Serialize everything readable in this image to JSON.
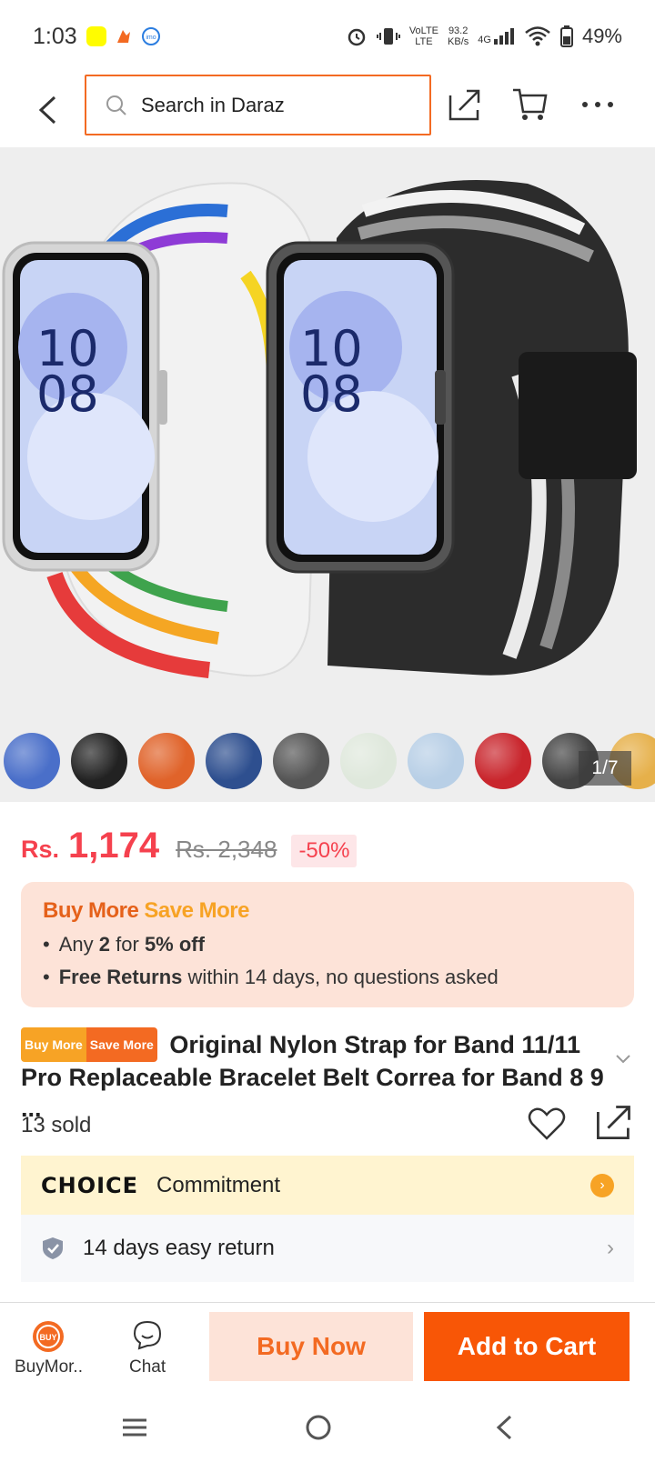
{
  "status": {
    "time": "1:03",
    "net_top": "VoLTE",
    "net_bottom": "LTE",
    "speed_value": "93.2",
    "speed_unit": "KB/s",
    "network": "4G",
    "battery": "49%"
  },
  "search": {
    "placeholder": "Search in Daraz"
  },
  "gallery": {
    "counter": "1/7",
    "thumbnail_colors": [
      "#4a6fc9",
      "#222222",
      "#e0632a",
      "#2e4f8f",
      "#555555",
      "#dfe8dc",
      "#b8cfe6",
      "#c9262d",
      "#444444",
      "#e6b04a"
    ]
  },
  "price": {
    "currency": "Rs.",
    "current": "1,174",
    "original": "Rs. 2,348",
    "discount": "-50%"
  },
  "promo": {
    "title_a": "Buy More",
    "title_b": "Save More",
    "line1_pre": "Any",
    "line1_qty": "2",
    "line1_mid": "for",
    "line1_off": "5% off",
    "line2_bold": "Free Returns",
    "line2_rest": "within 14 days, no questions asked"
  },
  "product": {
    "badge_a": "Buy More",
    "badge_b": "Save More",
    "title": "Original Nylon Strap for Band 11/11 Pro Replaceable Bracelet Belt Correa for Band 8 9 ...",
    "sold": "13 sold"
  },
  "choice": {
    "logo": "CHOICE",
    "text": "Commitment"
  },
  "returns": {
    "text": "14 days easy return"
  },
  "actions": {
    "buymore_label": "BuyMor..",
    "chat_label": "Chat",
    "buy_now": "Buy Now",
    "add_to_cart": "Add to Cart"
  },
  "colors": {
    "accent": "#f85606",
    "price": "#f5414e",
    "search_border": "#f36a22"
  }
}
